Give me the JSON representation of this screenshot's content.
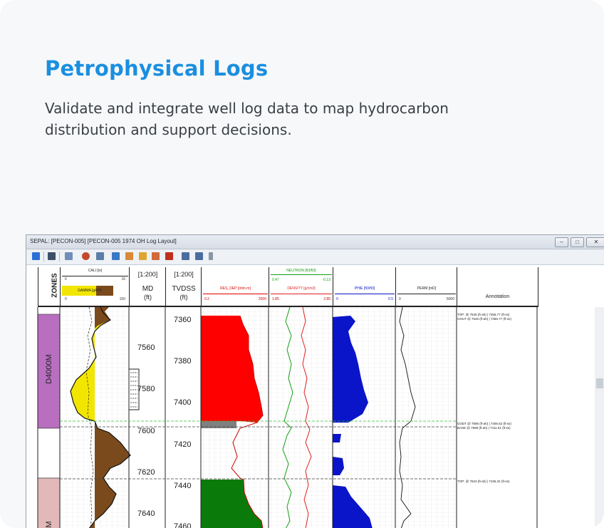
{
  "card": {
    "title": "Petrophysical Logs",
    "description": "Validate and integrate well log data to map hydrocarbon distribution and support decisions."
  },
  "window": {
    "title": "SEPAL: [PECON-005] [PECON-005 1974 OH Log Layout]"
  },
  "tracks": {
    "zones": {
      "header": "ZONES"
    },
    "cali": {
      "name": "CALI [in]",
      "min": "6",
      "max": "16",
      "color": "#000000"
    },
    "gamma": {
      "name": "GAMMA [gAPI]",
      "min": "0",
      "max": "150",
      "fill_color": "#f2e600",
      "shale_color": "#7b4a1c"
    },
    "md": {
      "scale": "[1:200]",
      "label": "MD",
      "unit": "(ft)",
      "ticks": [
        "7560",
        "7580",
        "7600",
        "7620",
        "7640"
      ]
    },
    "tvdss": {
      "scale": "[1:200]",
      "label": "TVDSS",
      "unit": "(ft)",
      "ticks": [
        "7360",
        "7380",
        "7400",
        "7420",
        "7440",
        "7460"
      ]
    },
    "res": {
      "name": "RES_DEP [ohm.m]",
      "min": "0.2",
      "max": "2000",
      "color": "#e00000",
      "fill_hc": "#ff0000",
      "fill_water": "#0a7a0a"
    },
    "neutron": {
      "name": "NEUTRON [ft3/ft3]",
      "min": "0.47",
      "max": "-0.13",
      "color": "#12a012"
    },
    "density": {
      "name": "DENSITY [g/cm3]",
      "min": "1.85",
      "max": "2.85",
      "color": "#e02020"
    },
    "phie": {
      "name": "PHIE [ft3/ft3]",
      "min": "0",
      "max": "0.5",
      "color": "#0a14c8"
    },
    "perm": {
      "name": "PERM [mD]",
      "min": "0",
      "max": "5000",
      "color": "#000000"
    },
    "annotation": {
      "header": "Annotation"
    }
  },
  "zones": [
    {
      "name": "D4000M",
      "color": "#b86fc0"
    },
    {
      "name": "",
      "color": "#ffffff"
    },
    {
      "name": "M",
      "color": "#e2b8b8"
    }
  ],
  "annotations": [
    "TOP: @ 7545 (ft-ah) | 7356.77 (ft-ss)",
    "GOUT @ 7545 (ft-ah) | 7356.77 (ft-ss)",
    "GODT @ 7595 (ft-ah) | 7406.62 (ft-ss)",
    "BASE @ 7598 (ft-ah) | 7411.61 (ft-ss)",
    "TOP: @ 7623 (ft-ah) | 7436.34 (ft-ss)"
  ]
}
